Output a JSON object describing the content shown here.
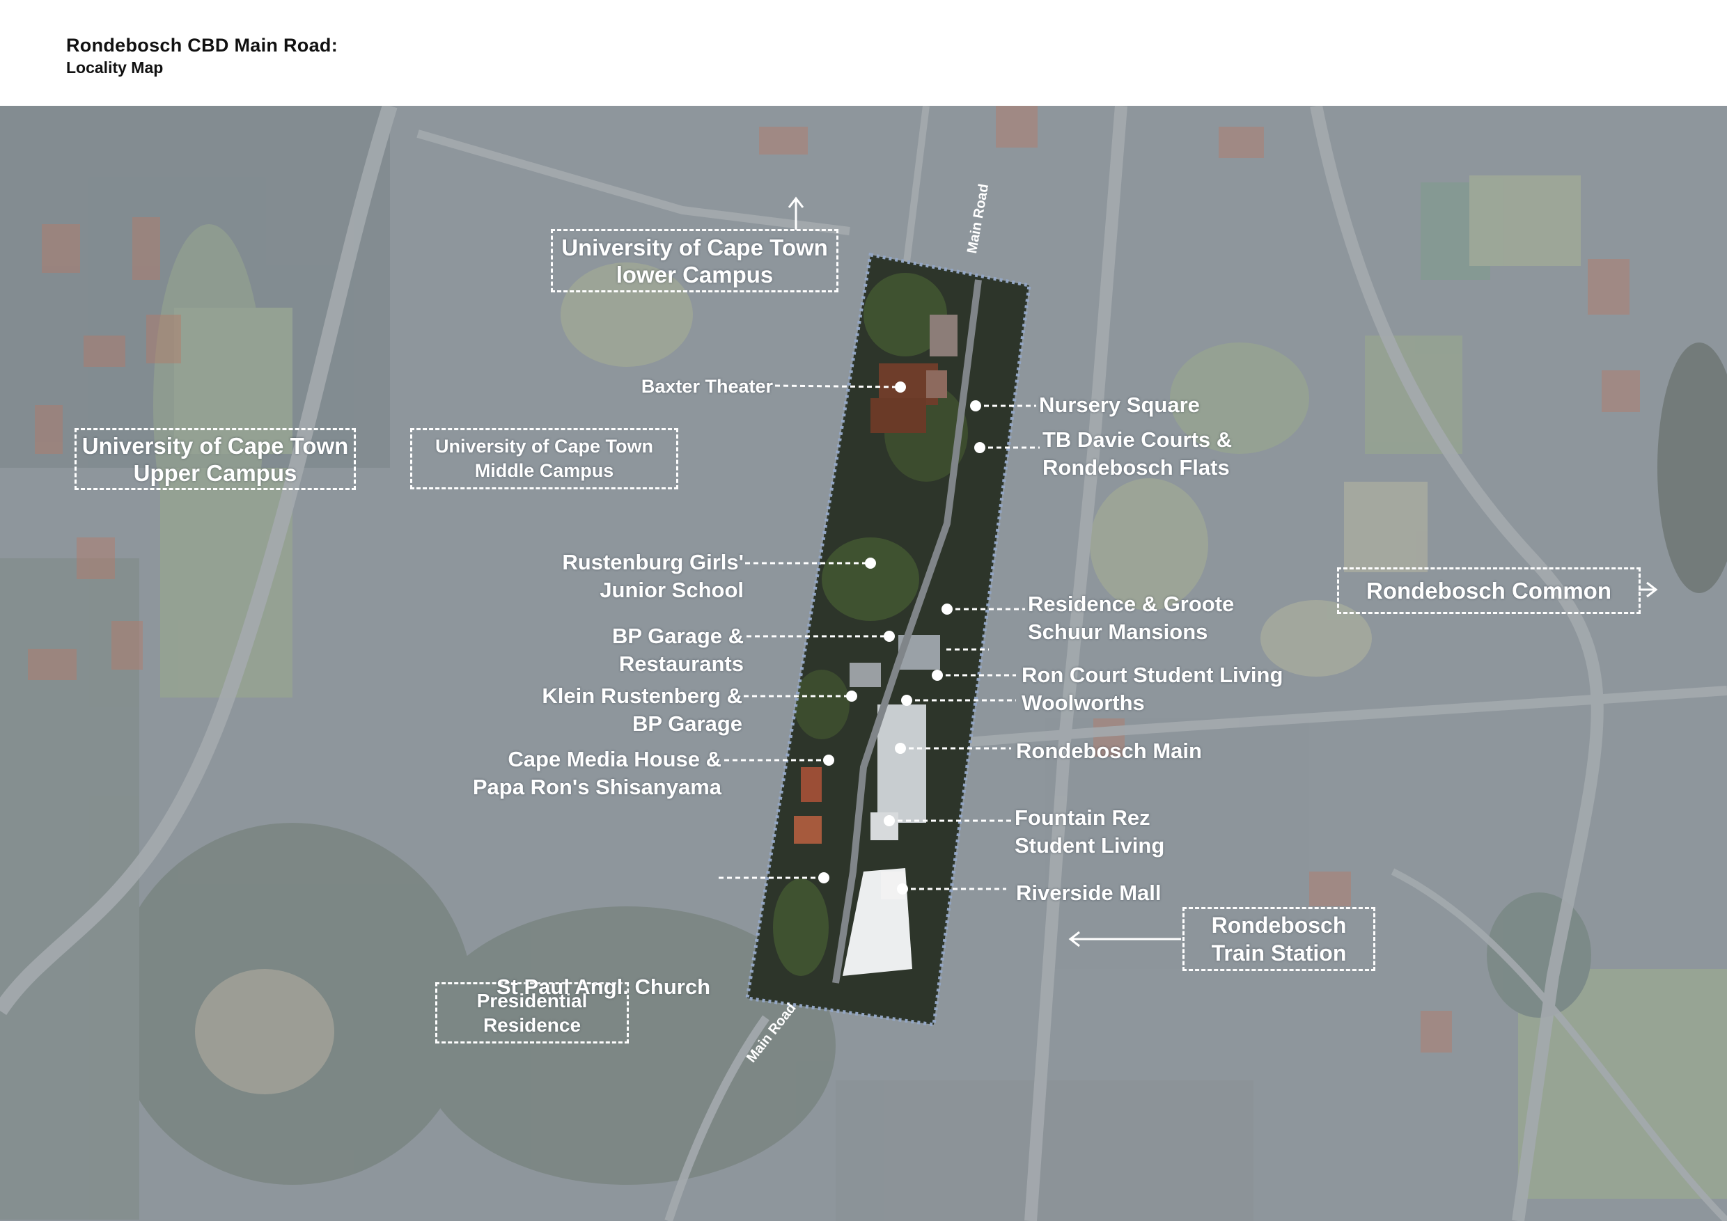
{
  "header": {
    "title": "Rondebosch CBD Main Road:",
    "subtitle": "Locality Map"
  },
  "map": {
    "roads": [
      "Main Road",
      "Main Road"
    ],
    "features": {
      "lower_campus": [
        "University of Cape Town",
        "lower Campus"
      ],
      "upper_campus": [
        "University of Cape Town",
        "Upper Campus"
      ],
      "middle_campus": [
        "University of Cape Town",
        "Middle Campus"
      ],
      "common": "Rondebosch Common",
      "train_station": [
        "Rondebosch",
        "Train Station"
      ],
      "presidential": [
        "Presidential",
        "Residence"
      ]
    },
    "landmarks_left": {
      "baxter": "Baxter Theater",
      "rustenburg": [
        "Rustenburg Girls'",
        "Junior School"
      ],
      "bp": [
        "BP Garage &",
        "Restaurants"
      ],
      "klein": [
        "Klein Rustenberg &",
        "BP Garage"
      ],
      "cape_media": [
        "Cape Media House &",
        "Papa Ron's Shisanyama"
      ],
      "st_paul": "St Paul Angl. Church"
    },
    "landmarks_right": {
      "nursery": "Nursery Square",
      "tb_davie": [
        "TB Davie Courts &",
        "Rondebosch Flats"
      ],
      "residence": [
        "Residence & Groote",
        "Schuur Mansions"
      ],
      "ron_court": "Ron Court Student Living",
      "woolworths": "Woolworths",
      "rondebosch_main": "Rondebosch Main",
      "fountain": [
        "Fountain Rez",
        "Student Living"
      ],
      "riverside": "Riverside Mall"
    }
  }
}
